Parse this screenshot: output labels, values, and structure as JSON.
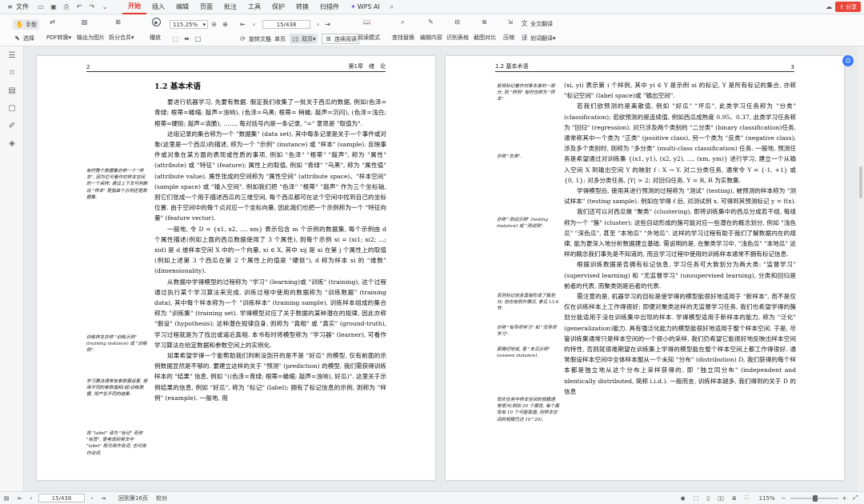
{
  "menubar": {
    "file": "文件",
    "tabs": [
      "开始",
      "插入",
      "编辑",
      "页面",
      "批注",
      "工具",
      "保护",
      "转换",
      "扫描件"
    ],
    "active_tab": "开始",
    "wps_ai": "WPS AI",
    "share": "分享"
  },
  "toolbar": {
    "hand": "手型",
    "select": "选择",
    "pdf_convert": "PDF转换",
    "export_image": "输出为图片",
    "split_merge": "拆分合并",
    "play": "播放",
    "zoom": "115.25%",
    "page_input": "15/438",
    "rotate": "旋转文档",
    "single": "单页",
    "double": "双页",
    "continuous": "连续阅读",
    "read_mode": "阅读模式",
    "find_replace": "查找替换",
    "edit_content": "编辑内容",
    "ocr": "识别表格",
    "screenshot": "截图对比",
    "compress": "压缩",
    "full_translate": "全文翻译",
    "word_translate": "划词翻译"
  },
  "left_page": {
    "header_num": "2",
    "header_chap": "第1章　绪　论",
    "section": "1.2 基本术语",
    "paragraphs": [
      "要进行机器学习, 先要有数据. 假定我们收集了一批关于西瓜的数据, 例如(色泽=青绿; 根蒂=蜷缩; 敲声=浊响), (色泽=乌黑; 根蒂= 稍蜷; 敲声=沉闷), (色泽=浅白; 根蒂=硬挺; 敲声=清脆), ……, 每对括号内是一条记录, \"=\" 意思是 \"取值为\".",
      "这组记录的集合称为一个 \"数据集\" (data set), 其中每条记录是关于一个事件或对象(这里是一个西瓜)的描述, 称为一个 \"示例\" (instance) 或 \"样本\" (sample). 反映事件或对象在某方面的表现或性质的事项, 例如 \"色泽\" \"根蒂\" \"敲声\", 称为 \"属性\" (attribute) 或 \"特征\" (feature); 属性上的取值, 例如 \"青绿\" \"乌黑\", 称为 \"属性值\" (attribute value). 属性张成的空间称为 \"属性空间\" (attribute space)、\"样本空间\" (sample space) 或 \"输入空间\". 例如我们把 \"色泽\" \"根蒂\" \"敲声\" 作为三个坐标轴, 则它们张成一个用于描述西瓜的三维空间, 每个西瓜都可在这个空间中找到自己的坐标位置. 由于空间中的每个点对应一个坐标向量, 因此我们也把一个示例称为一个 \"特征向量\" (feature vector).",
      "一般地, 令 D = {x1, x2, ..., xm} 表示包含 m 个示例的数据集, 每个示例由 d 个属性描述(例如上面的西瓜数据使用了 3 个属性), 则每个示例 xi = (xi1; xi2; ...; xid) 是 d 维样本空间 X 中的一个向量, xi ∈ X, 其中 xij 是 xi 在第 j 个属性上的取值(例如上述第 3 个西瓜在第 2 个属性上的值是 \"硬挺\"), d 称为样本 xi 的 \"维数\" (dimensionality).",
      "从数据中学得模型的过程称为 \"学习\" (learning)或 \"训练\" (training), 这个过程通过执行某个学习算法来完成. 训练过程中使用的数据称为 \"训练数据\" (training data), 其中每个样本称为一个 \"训练样本\" (training sample), 训练样本组成的集合称为 \"训练集\" (training set). 学得模型对应了关于数据的某种潜在的规律, 因此亦称 \"假设\" (hypothesis); 这种潜在规律自身, 则称为 \"真相\" 或 \"真实\" (ground-truth), 学习过程就是为了找出或逼近真相. 本书有时将模型称为 \"学习器\" (learner), 可看作学习算法在给定数据和参数空间上的实例化.",
      "如果希望学得一个能帮助我们判断没剖开的是不是 \"好瓜\" 的模型, 仅有前面的示例数据显然是不够的. 要建立这样的关于 \"预测\" (prediction) 的模型, 我们需获得训练样本的 \"结果\" 信息, 例如 \"((色泽=青绿; 根蒂=蜷缩; 敲声=浊响), 好瓜)\". 这里关于示例结果的信息, 例如 \"好瓜\", 称为 \"标记\" (label); 拥有了标记信息的示例, 则称为 \"样例\" (example). 一般地, 用"
    ],
    "notes": [
      "有时整个数据集亦称一个 \"样本\", 因为它可看作对样本空间的一个采样; 通过上下文可判断出 \"样本\" 是指单个示例还是数据集.",
      "训练样本亦称 \"训练示例\" (training instance) 或 \"训练例\".",
      "学习算法通常有参数需设置, 使用不同的参数值和(或)训练数据, 将产生不同的结果.",
      "将 \"label\" 译为 \"标记\" 而非 \"标签\", 是考虑到英文中 \"label\" 既可用作名词, 也可用作动词."
    ]
  },
  "right_page": {
    "header_sec": "1.2 基本术语",
    "header_num": "3",
    "paragraphs": [
      "(xi, yi) 表示第 i 个样例, 其中 yi ∈ Y 是示例 xi 的标记, Y 是所有标记的集合, 亦称 \"标记空间\" (label space)或 \"输出空间\".",
      "若我们欲预测的是离散值, 例如 \"好瓜\" \"坏瓜\", 此类学习任务称为 \"分类\" (classification); 若欲预测的是连续值, 例如西瓜成熟度 0.95、0.37, 此类学习任务称为 \"回归\" (regression). 对只涉及两个类别的 \"二分类\" (binary classification)任务, 通常称其中一个类为 \"正类\" (positive class), 另一个类为 \"反类\" (negative class); 涉及多个类别时, 则称为 \"多分类\" (multi-class classification) 任务. 一般地, 预测任务是希望通过对训练集 {(x1, y1), (x2, y2), ..., (xm, ym)} 进行学习, 建立一个从输入空间 X 到输出空间 Y 的映射 f : X → Y. 对二分类任务, 通常令 Y = {-1, +1} 或 {0, 1}; 对多分类任务, |Y| > 2; 对回归任务, Y = R, R 为实数集.",
      "学得模型后, 使用其进行预测的过程称为 \"测试\" (testing), 被预测的样本称为 \"测试样本\" (testing sample). 例如在学得 f 后, 对测试例 x, 可得到其预测标记 y = f(x).",
      "我们还可以对西瓜做 \"聚类\" (clustering), 即将训练集中的西瓜分成若干组, 每组称为一个 \"簇\" (cluster); 这些自动形成的簇可能对应一些潜在的概念划分, 例如 \"浅色瓜\" \"深色瓜\", 甚至 \"本地瓜\" \"外地瓜\". 这样的学习过程有助于我们了解数据内在的规律, 能为更深入地分析数据建立基础. 需说明的是, 在聚类学习中, \"浅色瓜\" \"本地瓜\" 这样的概念我们事先是不知道的, 而且学习过程中使用的训练样本通常不拥有标记信息.",
      "根据训练数据是否拥有标记信息, 学习任务可大致划分为两大类: \"监督学习\" (supervised learning) 和 \"无监督学习\" (unsupervised learning), 分类和回归是前者的代表, 而聚类则是后者的代表.",
      "需注意的是, 机器学习的目标是使学得的模型能很好地适用于 \"新样本\", 而不是仅仅在训练样本上工作得很好; 即便对聚类这样的无监督学习任务, 我们也希望学得的簇划分能适用于没在训练集中出现的样本. 学得模型适用于新样本的能力, 称为 \"泛化\" (generalization)能力. 具有强泛化能力的模型能很好地适用于整个样本空间. 于是, 尽管训练集通常只是样本空间的一个很小的采样, 我们仍希望它能很好地反映出样本空间的特性, 否则就很难期望在训练集上学得的模型能在整个样本空间上都工作得很好. 通常假设样本空间中全体样本服从一个未知 \"分布\" (distribution) D, 我们获得的每个样本都是独立地从这个分布上采样获得的, 即 \"独立同分布\" (independent and identically distributed, 简称 i.i.d.). 一般而言, 训练样本越多, 我们得到的关于 D 的信息"
    ],
    "notes": [
      "若将标记看作对象本身的一部分, 则 \"样例\" 有时也称为 \"样本\".",
      "亦称 \"负类\".",
      "亦称 \"测试示例\" (testing instance) 或 \"测试例\".",
      "否则标记信息直接形成了簇划分; 但也有例外情况, 参见 13.6 节.",
      "亦称 \"有导师学习\" 和 \"无导师学习\".",
      "更确切地说, 是 \"未见示例\" (unseen instance).",
      "现实任务中样本空间的规模通常很大(例如 20 个属性, 每个属性有 10 个可能取值, 则样本空间的规模已达 10^20)."
    ]
  },
  "status": {
    "page": "15/438",
    "return": "回到第16页",
    "proof": "校对",
    "zoom": "115%"
  }
}
